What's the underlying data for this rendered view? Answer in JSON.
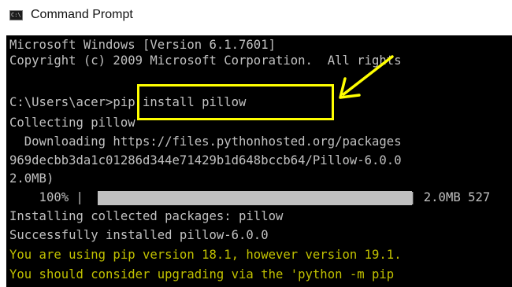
{
  "window": {
    "title": "Command Prompt",
    "icon_label": "C:\\"
  },
  "console": {
    "lines": [
      {
        "text": "Microsoft Windows [Version 6.1.7601]",
        "style": "normal"
      },
      {
        "text": "Copyright (c) 2009 Microsoft Corporation.  All rights",
        "style": "normal"
      },
      {
        "text": "",
        "style": "normal"
      },
      {
        "text": "C:\\Users\\acer>pip install pillow",
        "style": "normal"
      },
      {
        "text": "Collecting pillow",
        "style": "normal"
      },
      {
        "text": "  Downloading https://files.pythonhosted.org/packages",
        "style": "normal"
      },
      {
        "text": "969decbb3da1c01286d344e71429b1d648bccb64/Pillow-6.0.0",
        "style": "normal"
      },
      {
        "text": "2.0MB)",
        "style": "normal"
      },
      {
        "text": "",
        "style": "normal"
      },
      {
        "text": "Installing collected packages: pillow",
        "style": "normal"
      },
      {
        "text": "Successfully installed pillow-6.0.0",
        "style": "normal"
      },
      {
        "text": "You are using pip version 18.1, however version 19.1.",
        "style": "warn"
      },
      {
        "text": "You should consider upgrading via the 'python -m pip",
        "style": "warn"
      }
    ],
    "progress": {
      "percent_label": "    100% |",
      "fraction": 1.0,
      "size_label": "| 2.0MB 527"
    }
  },
  "annotation": {
    "highlight_color": "#ffff00",
    "arrow_color": "#ffff00"
  },
  "colors": {
    "console_bg": "#000000",
    "console_text": "#c0c0c0",
    "warning_text": "#c0c000"
  }
}
